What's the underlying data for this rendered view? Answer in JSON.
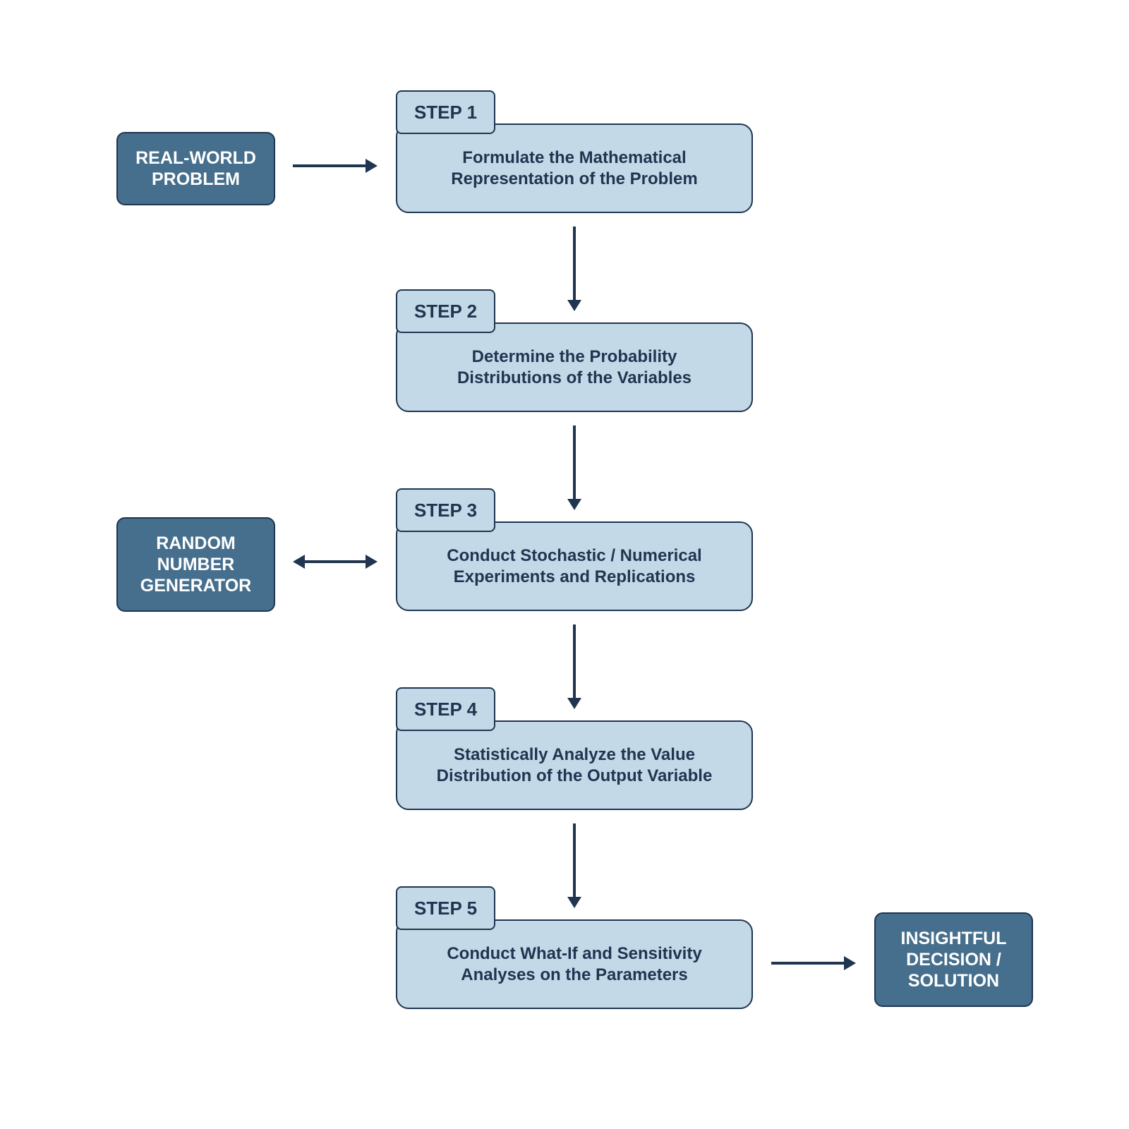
{
  "nodes": {
    "problem": "REAL-WORLD\nPROBLEM",
    "rng": "RANDOM\nNUMBER\nGENERATOR",
    "solution": "INSIGHTFUL\nDECISION /\nSOLUTION"
  },
  "steps": [
    {
      "label": "STEP 1",
      "text": "Formulate the Mathematical\nRepresentation of the Problem"
    },
    {
      "label": "STEP 2",
      "text": "Determine the Probability\nDistributions of the Variables"
    },
    {
      "label": "STEP 3",
      "text": "Conduct Stochastic / Numerical\nExperiments and Replications"
    },
    {
      "label": "STEP 4",
      "text": "Statistically Analyze the Value\nDistribution of the Output Variable"
    },
    {
      "label": "STEP 5",
      "text": "Conduct What-If and Sensitivity\nAnalyses on the Parameters"
    }
  ],
  "colors": {
    "dark": "#466f8d",
    "light": "#c3d9e7",
    "ink": "#1f3550"
  }
}
